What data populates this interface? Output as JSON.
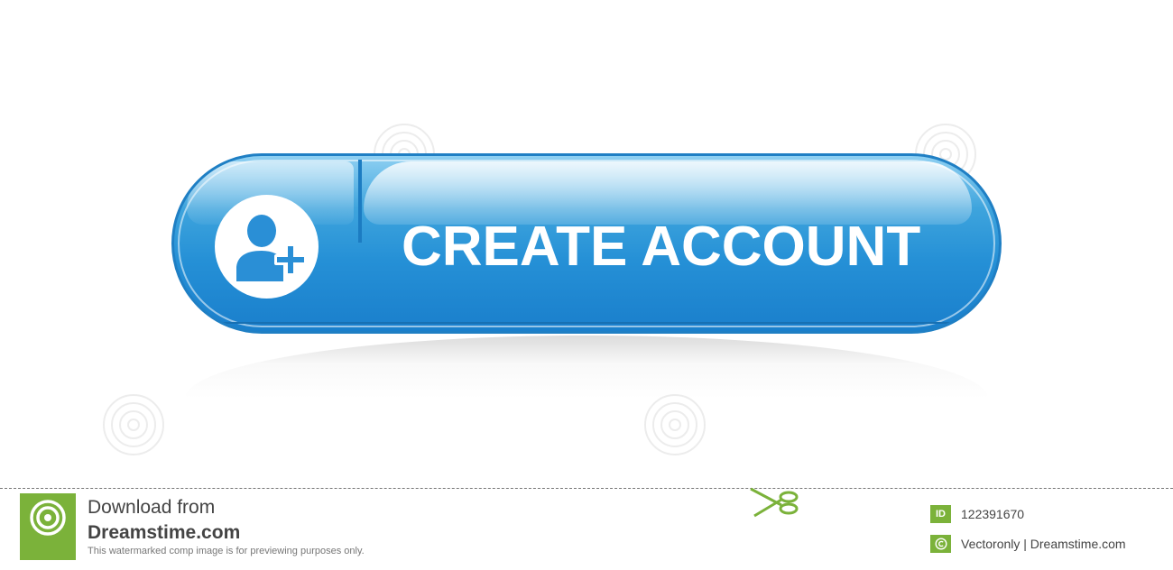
{
  "button": {
    "label": "CREATE ACCOUNT",
    "icon": "user-add-icon",
    "colors": {
      "fill_top": "#8fd0f2",
      "fill_bottom": "#1a7fcc",
      "border": "#1f7fc4",
      "text": "#ffffff"
    }
  },
  "footer": {
    "download_label": "Download from",
    "site_name": "Dreamstime.com",
    "note": "This watermarked comp image is for previewing purposes only.",
    "id_badge": "ID",
    "image_id": "122391670",
    "copyright_icon": "copyright-icon",
    "credit": "Vectoronly | Dreamstime.com",
    "accent_color": "#7bb23a"
  }
}
